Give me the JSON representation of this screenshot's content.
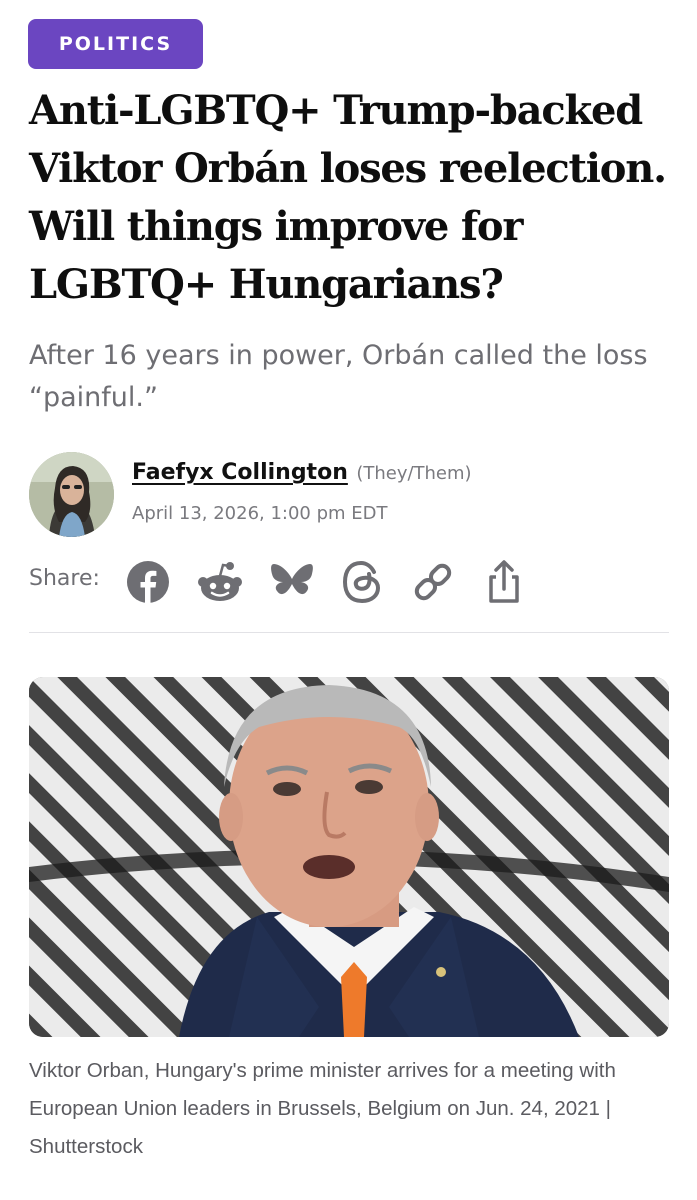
{
  "article": {
    "category": "POLITICS",
    "headline": "Anti-LGBTQ+ Trump-backed Viktor Orbán loses reelection. Will things improve for LGBTQ+ Hungarians?",
    "dek": "After 16 years in power, Orbán called the loss “painful.”"
  },
  "author": {
    "name": "Faefyx Collington",
    "pronouns": "(They/Them)",
    "date": "April 13, 2026, 1:00 pm EDT"
  },
  "share": {
    "label": "Share:",
    "icons": [
      "facebook-icon",
      "reddit-icon",
      "bluesky-icon",
      "threads-icon",
      "link-icon",
      "share-icon"
    ]
  },
  "image": {
    "caption": "Viktor Orban, Hungary's prime minister arrives for a meeting with European Union leaders in Brussels, Belgium on Jun. 24, 2021 | Shutterstock"
  },
  "colors": {
    "accent": "#6b46c1",
    "icon": "#6e6e73",
    "muted_text": "#6e6e73"
  }
}
